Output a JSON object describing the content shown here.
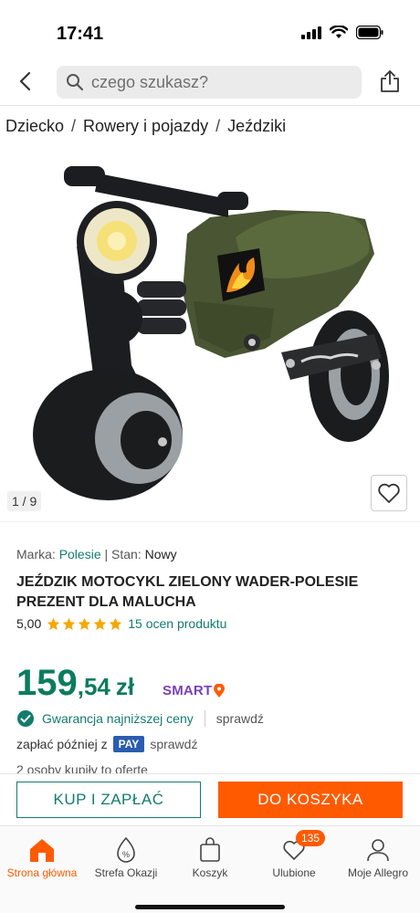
{
  "status_bar": {
    "time": "17:41"
  },
  "header": {
    "search_placeholder": "czego szukasz?"
  },
  "breadcrumb": [
    "Dziecko",
    "Rowery i pojazdy",
    "Jeździki"
  ],
  "gallery": {
    "counter": "1 / 9"
  },
  "product": {
    "brand_label": "Marka:",
    "brand": "Polesie",
    "condition_label": "| Stan:",
    "condition": "Nowy",
    "title": "JEŹDZIK MOTOCYKL ZIELONY WADER-POLESIE PREZENT DLA MALUCHA",
    "rating_value": "5,00",
    "rating_stars": 5,
    "rating_count_text": "15 ocen produktu",
    "price_int": "159",
    "price_dec": ",54",
    "currency": "zł",
    "smart_label": "SMART",
    "guarantee": "Gwarancja najniższej ceny",
    "guarantee_check": "sprawdź",
    "pay_later": "zapłać później z",
    "pay_badge": "PAY",
    "pay_check": "sprawdź",
    "bought": "2 osoby kupiły to oferte"
  },
  "actions": {
    "buy_label": "KUP I ZAPŁAĆ",
    "cart_label": "DO KOSZYKA"
  },
  "nav": [
    {
      "label": "Strona główna",
      "icon": "home-icon"
    },
    {
      "label": "Strefa Okazji",
      "icon": "deal-icon"
    },
    {
      "label": "Koszyk",
      "icon": "bag-icon"
    },
    {
      "label": "Ulubione",
      "icon": "heart-icon",
      "badge": "135"
    },
    {
      "label": "Moje Allegro",
      "icon": "user-icon"
    }
  ],
  "colors": {
    "accent": "#ff5a00",
    "green": "#137c6c",
    "price": "#0c7c5e",
    "smart": "#7a3fb7"
  }
}
